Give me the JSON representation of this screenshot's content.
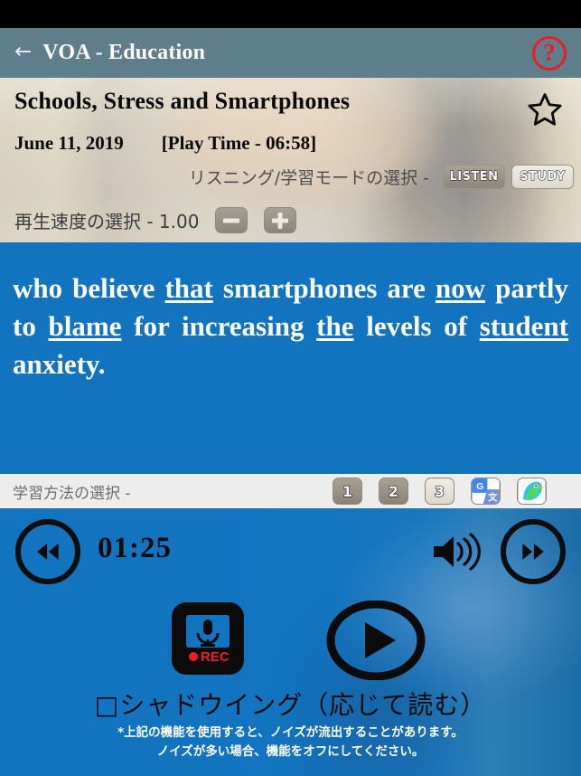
{
  "appbar": {
    "back_icon": "left-arrow-icon",
    "title": "VOA - Education",
    "help_icon": "question-mark-icon",
    "help_label": "?",
    "bg_color": "#5f7e8c",
    "help_color": "#ef1c26"
  },
  "article": {
    "title": "Schools, Stress and Smartphones",
    "date": "June 11, 2019",
    "play_time": "[Play Time - 06:58]",
    "favorite_icon": "star-outline-icon"
  },
  "mode": {
    "label": "リスニング/学習モードの選択 -",
    "listen_label": "LISTEN",
    "study_label": "STUDY",
    "selected": "LISTEN"
  },
  "speed": {
    "label": "再生速度の選択 - 1.00",
    "value": "1.00",
    "minus_icon": "minus-icon",
    "plus_icon": "plus-icon"
  },
  "text_panel": {
    "bg_color": "#1273be",
    "words": [
      {
        "text": "who",
        "underlined": false
      },
      {
        "text": "believe",
        "underlined": false
      },
      {
        "text": "that",
        "underlined": true
      },
      {
        "text": "smartphones",
        "underlined": false
      },
      {
        "text": "are",
        "underlined": false
      },
      {
        "text": "now",
        "underlined": true
      },
      {
        "text": "partly",
        "underlined": false
      },
      {
        "text": "to",
        "underlined": false
      },
      {
        "text": "blame",
        "underlined": true
      },
      {
        "text": "for",
        "underlined": false
      },
      {
        "text": "increasing",
        "underlined": false
      },
      {
        "text": "the",
        "underlined": true
      },
      {
        "text": "levels",
        "underlined": false
      },
      {
        "text": "of",
        "underlined": false
      },
      {
        "text": "student",
        "underlined": true
      },
      {
        "text": "anxiety.",
        "underlined": false
      }
    ],
    "full_text": "who believe that smartphones are now partly to blame for increasing the levels of student anxiety."
  },
  "study_bar": {
    "label": "学習方法の選択 -",
    "buttons": [
      {
        "label": "1",
        "icon": "number-1-icon",
        "state": "on"
      },
      {
        "label": "2",
        "icon": "number-2-icon",
        "state": "on"
      },
      {
        "label": "3",
        "icon": "number-3-icon",
        "state": "off"
      }
    ],
    "apps": [
      {
        "icon": "google-translate-icon",
        "label": "G"
      },
      {
        "icon": "papago-parrot-icon",
        "label": ""
      }
    ]
  },
  "player": {
    "elapsed": "01:25",
    "rewind_icon": "rewind-icon",
    "forward_icon": "fast-forward-icon",
    "volume_icon": "volume-high-icon",
    "record_icon": "microphone-rec-icon",
    "record_label": "REC",
    "play_icon": "play-icon",
    "shadowing_label": "□シャドウイング（応じて読む）",
    "note_line1": "*上記の機能を使用すると、ノイズが流出することがあります。",
    "note_line2": "ノイズが多い場合、機能をオフにしてください。"
  }
}
